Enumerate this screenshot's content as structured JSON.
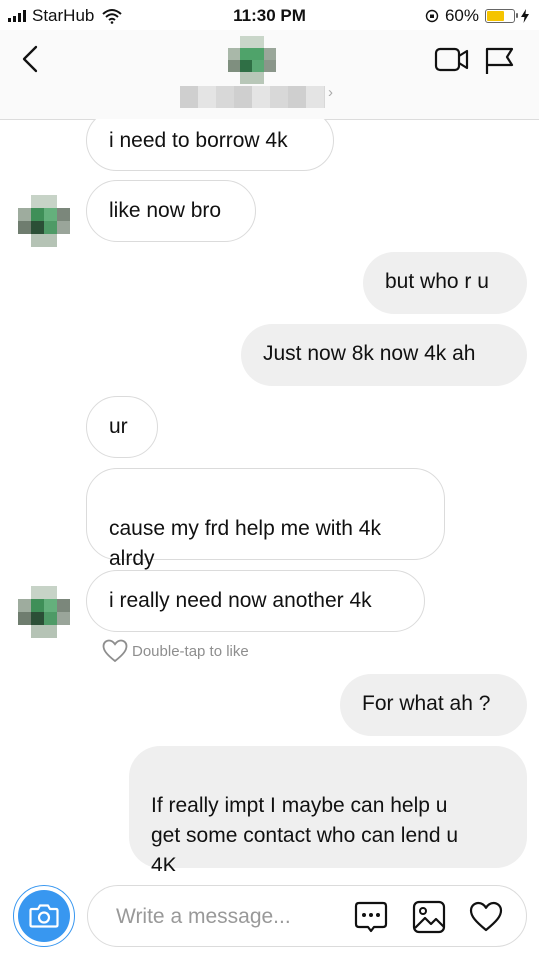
{
  "status_bar": {
    "carrier": "StarHub",
    "time": "11:30 PM",
    "battery": "60%",
    "battery_level": 0.6
  },
  "header": {
    "chevron": "›"
  },
  "messages": [
    {
      "text": "i need to borrow 4k",
      "direction": "in"
    },
    {
      "text": "like now bro",
      "direction": "in",
      "avatar": true
    },
    {
      "text": "but who r u",
      "direction": "out"
    },
    {
      "text": "Just now 8k now 4k ah",
      "direction": "out"
    },
    {
      "text": "ur",
      "direction": "in"
    },
    {
      "text": "cause my frd help me with 4k\nalrdy",
      "direction": "in"
    },
    {
      "text": "i really need now another 4k",
      "direction": "in",
      "avatar": true
    },
    {
      "text": "For what ah ?",
      "direction": "out"
    },
    {
      "text": "If really impt I maybe can help u\nget some contact who can lend u\n4K",
      "direction": "out"
    }
  ],
  "like_hint": "Double-tap to like",
  "composer": {
    "placeholder": "Write a message..."
  },
  "icons": [
    "back-icon",
    "video-call-icon",
    "flag-icon",
    "camera-icon",
    "message-options-icon",
    "gallery-icon",
    "heart-icon"
  ],
  "colors": {
    "accent": "#3897f0",
    "outgoing_bubble": "#efefef",
    "incoming_border": "#dbdbdb",
    "battery": "#f5c400"
  }
}
